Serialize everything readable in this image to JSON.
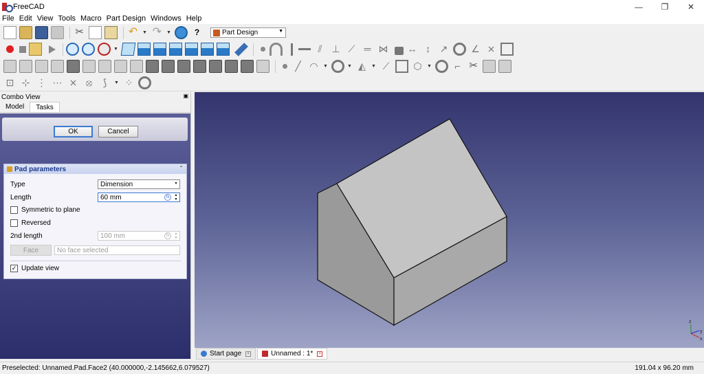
{
  "window": {
    "title": "FreeCAD",
    "minimize": "—",
    "restore": "❐",
    "close": "✕"
  },
  "menu": [
    "File",
    "Edit",
    "View",
    "Tools",
    "Macro",
    "Part Design",
    "Windows",
    "Help"
  ],
  "toolbar": {
    "workbench": "Part Design",
    "undo_icon": "↶",
    "redo_icon": "↷",
    "cut_icon": "✂",
    "help_icon": "?"
  },
  "combo": {
    "title": "Combo View",
    "tabs": [
      "Model",
      "Tasks"
    ],
    "active_tab": "Tasks"
  },
  "task": {
    "ok": "OK",
    "cancel": "Cancel",
    "panel_title": "Pad parameters",
    "type_label": "Type",
    "type_value": "Dimension",
    "length_label": "Length",
    "length_value": "60 mm",
    "symmetric_label": "Symmetric to plane",
    "reversed_label": "Reversed",
    "length2_label": "2nd length",
    "length2_value": "100 mm",
    "face_button": "Face",
    "face_placeholder": "No face selected",
    "update_label": "Update view",
    "update_checked": "✓"
  },
  "documents": [
    {
      "label": "Start page",
      "active": false
    },
    {
      "label": "Unnamed : 1*",
      "active": true
    }
  ],
  "status": {
    "message": "Preselected: Unnamed.Pad.Face2 (40.000000,-2.145662,6.079527)",
    "dimensions": "191.04 x 96.20 mm"
  },
  "axis": {
    "x": "x",
    "y": "y",
    "z": "z"
  },
  "colors": {
    "viewport_top": "#33346e",
    "viewport_bottom": "#9ea3c6",
    "solid_top": "#c4c4c4",
    "solid_side": "#9b9b9b",
    "solid_front": "#a8a8a8"
  }
}
